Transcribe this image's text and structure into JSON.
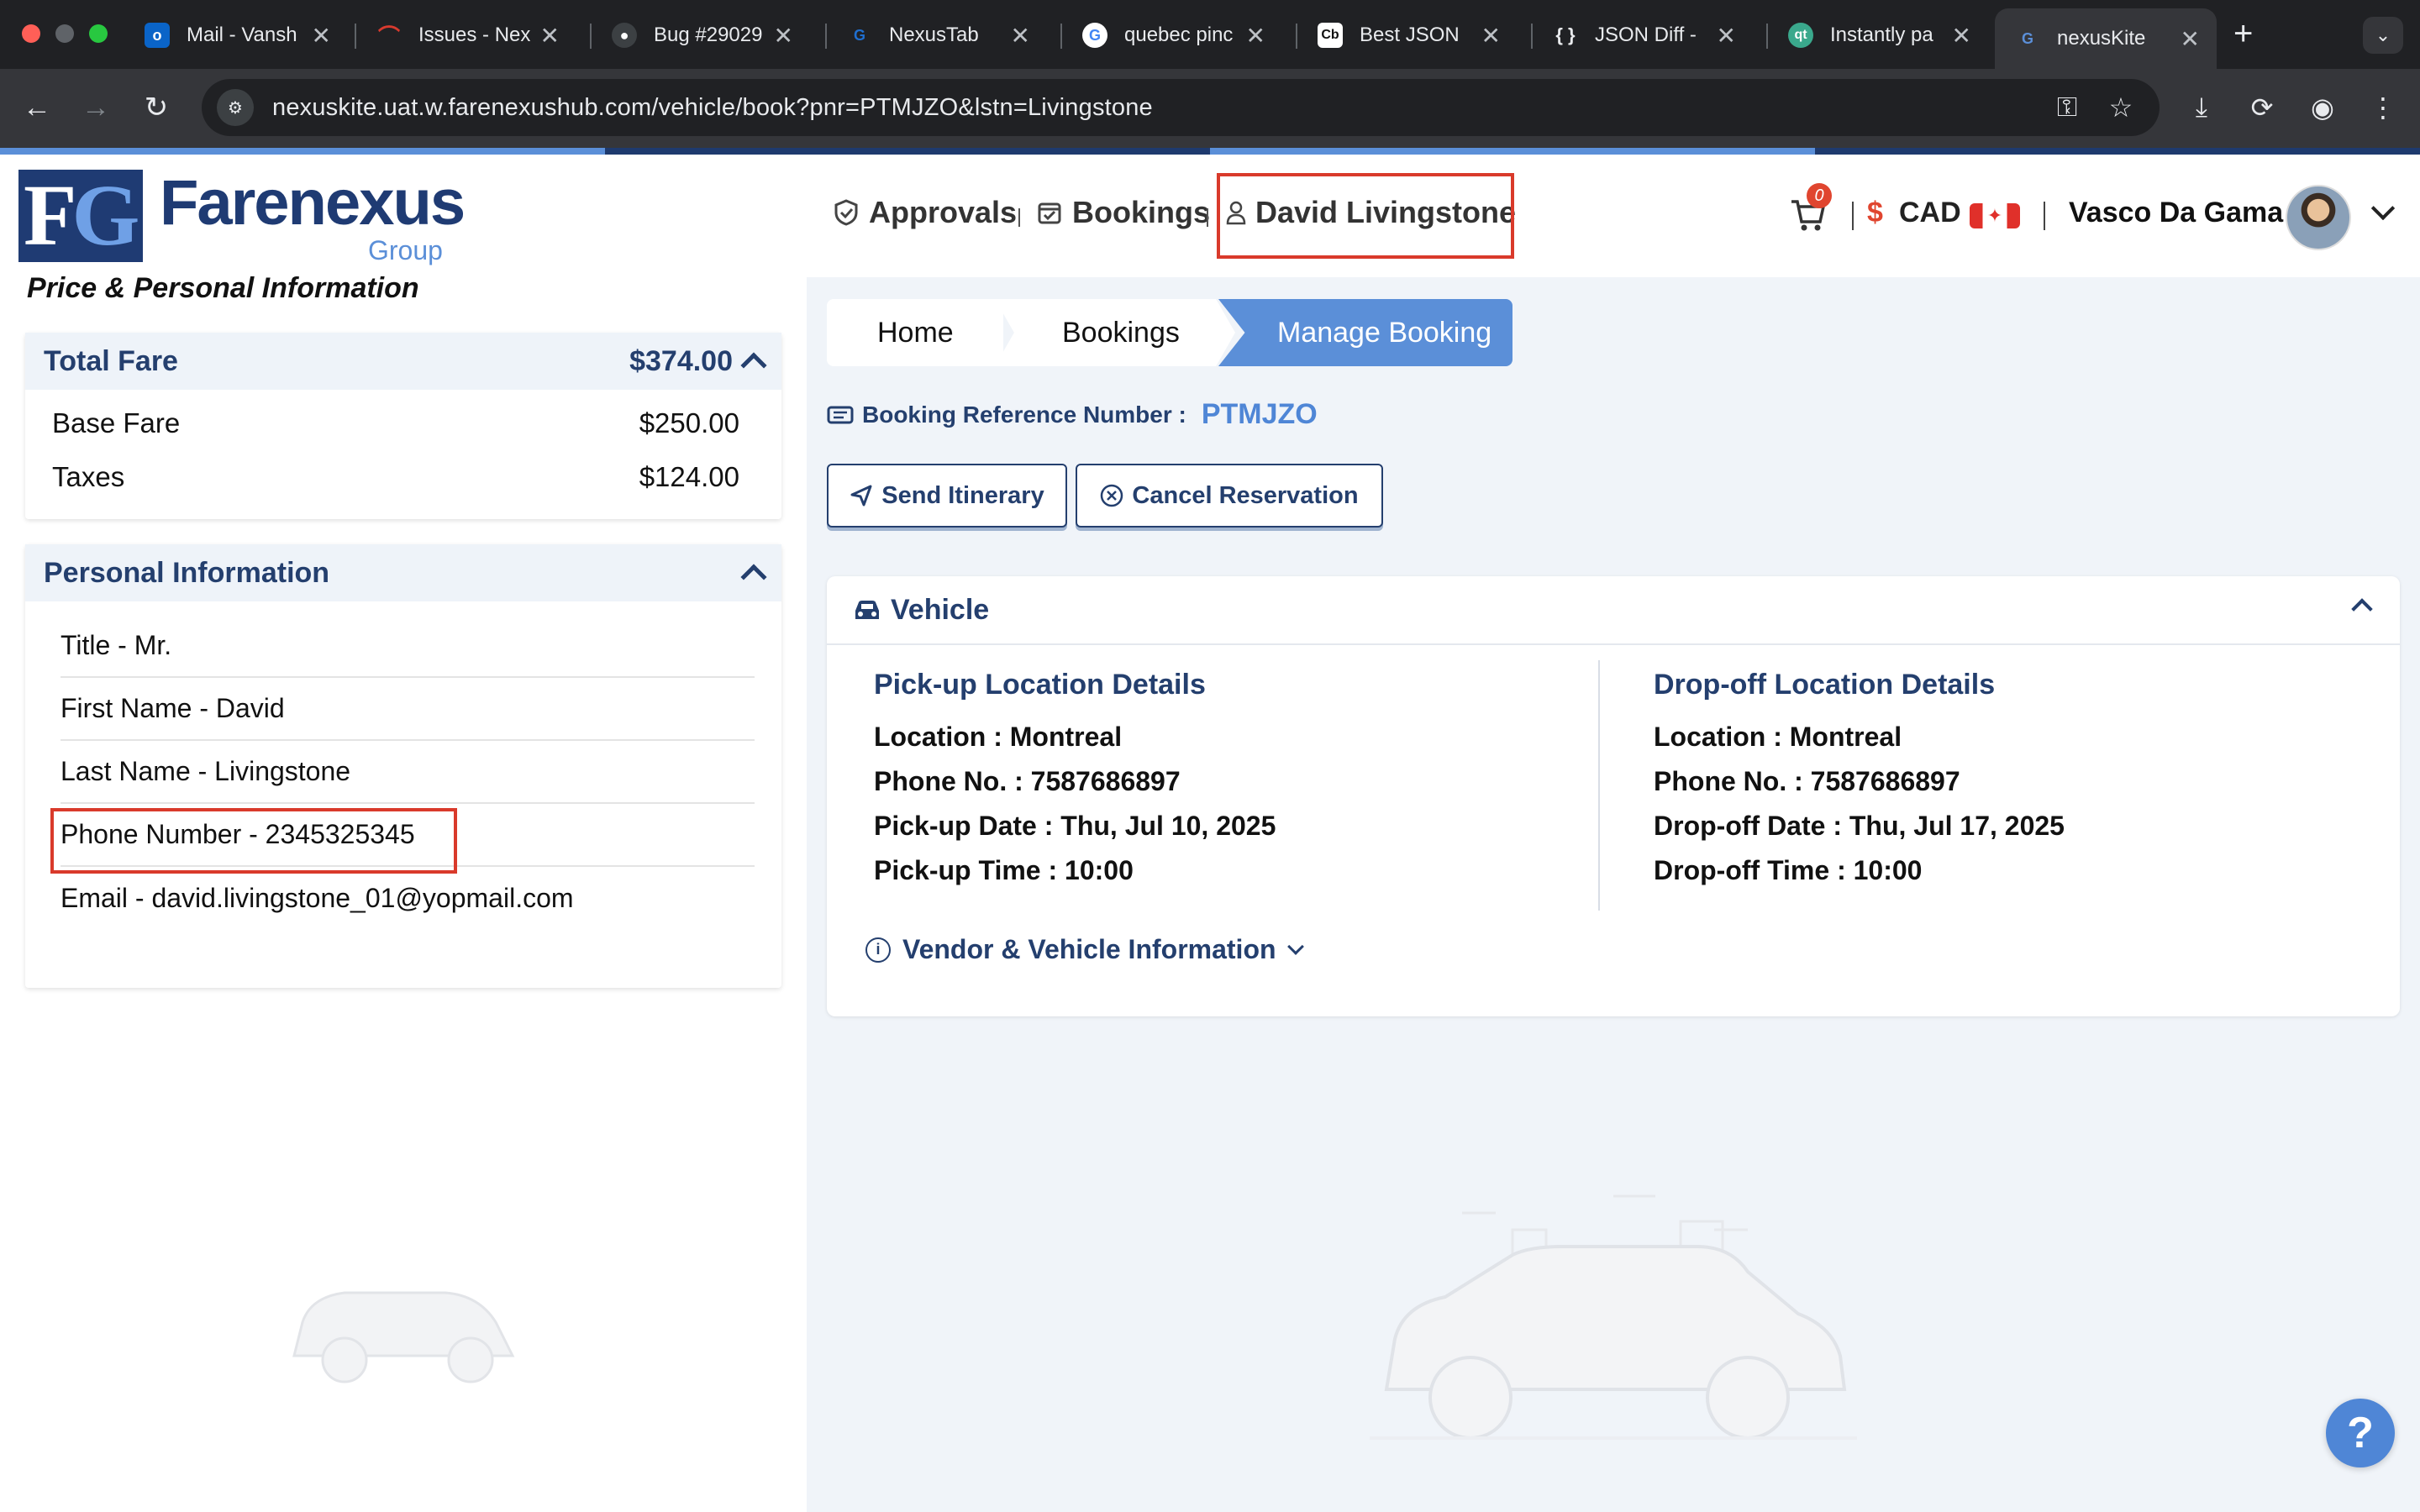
{
  "browser": {
    "tabs": [
      {
        "title": "Mail - Vansh",
        "favicon": "outlook-icon",
        "color": "#0a64c8"
      },
      {
        "title": "Issues - Nex",
        "favicon": "jira-icon",
        "color": "#d83a2e"
      },
      {
        "title": "Bug #29029",
        "favicon": "bug-tracker-icon",
        "color": "#3c4043"
      },
      {
        "title": "NexusTab",
        "favicon": "nexus-icon",
        "color": "#1f3b73"
      },
      {
        "title": "quebec pinc",
        "favicon": "google-icon",
        "color": "#ffffff"
      },
      {
        "title": "Best JSON",
        "favicon": "cb-icon",
        "color": "#ffffff"
      },
      {
        "title": "JSON Diff -",
        "favicon": "braces-icon",
        "color": "#202124"
      },
      {
        "title": "Instantly pa",
        "favicon": "qt-icon",
        "color": "#3aa88c"
      },
      {
        "title": "nexusKite",
        "favicon": "nexuskite-icon",
        "color": "#1f3b73"
      }
    ],
    "url": "nexuskite.uat.w.farenexushub.com/vehicle/book?pnr=PTMJZO&lstn=Livingstone"
  },
  "logo": {
    "mark_f": "F",
    "mark_g": "G",
    "name": "Farenexus",
    "sub": "Group"
  },
  "left": {
    "caption": "Price & Personal Information",
    "fare": {
      "title": "Total Fare",
      "total": "$374.00",
      "rows": [
        {
          "label": "Base Fare",
          "value": "$250.00"
        },
        {
          "label": "Taxes",
          "value": "$124.00"
        }
      ]
    },
    "personal": {
      "title": "Personal Information",
      "rows": [
        "Title - Mr.",
        "First Name - David",
        "Last Name - Livingstone",
        "Phone Number - 2345325345",
        "Email - david.livingstone_01@yopmail.com"
      ]
    }
  },
  "header": {
    "nav": {
      "approvals": "Approvals",
      "bookings": "Bookings",
      "traveler": "David Livingstone"
    },
    "cart_count": "0",
    "currency_symbol": "$",
    "currency": "CAD",
    "user": "Vasco Da Gama"
  },
  "breadcrumb": {
    "home": "Home",
    "bookings": "Bookings",
    "current": "Manage Booking"
  },
  "booking": {
    "ref_label": "Booking Reference Number :",
    "ref_value": "PTMJZO",
    "send_label": "Send Itinerary",
    "cancel_label": "Cancel Reservation"
  },
  "vehicle": {
    "title": "Vehicle",
    "pickup": {
      "heading": "Pick-up Location Details",
      "location": "Location : Montreal",
      "phone": "Phone No. : 7587686897",
      "date": "Pick-up Date : Thu, Jul 10, 2025",
      "time": "Pick-up Time : 10:00"
    },
    "dropoff": {
      "heading": "Drop-off Location Details",
      "location": "Location : Montreal",
      "phone": "Phone No. : 7587686897",
      "date": "Drop-off Date : Thu, Jul 17, 2025",
      "time": "Drop-off Time : 10:00"
    },
    "vendor_label": "Vendor & Vehicle Information"
  },
  "help": "?",
  "colors": {
    "brand": "#1f3b73",
    "accent": "#5b8fd8",
    "highlight": "#d93a2b"
  }
}
